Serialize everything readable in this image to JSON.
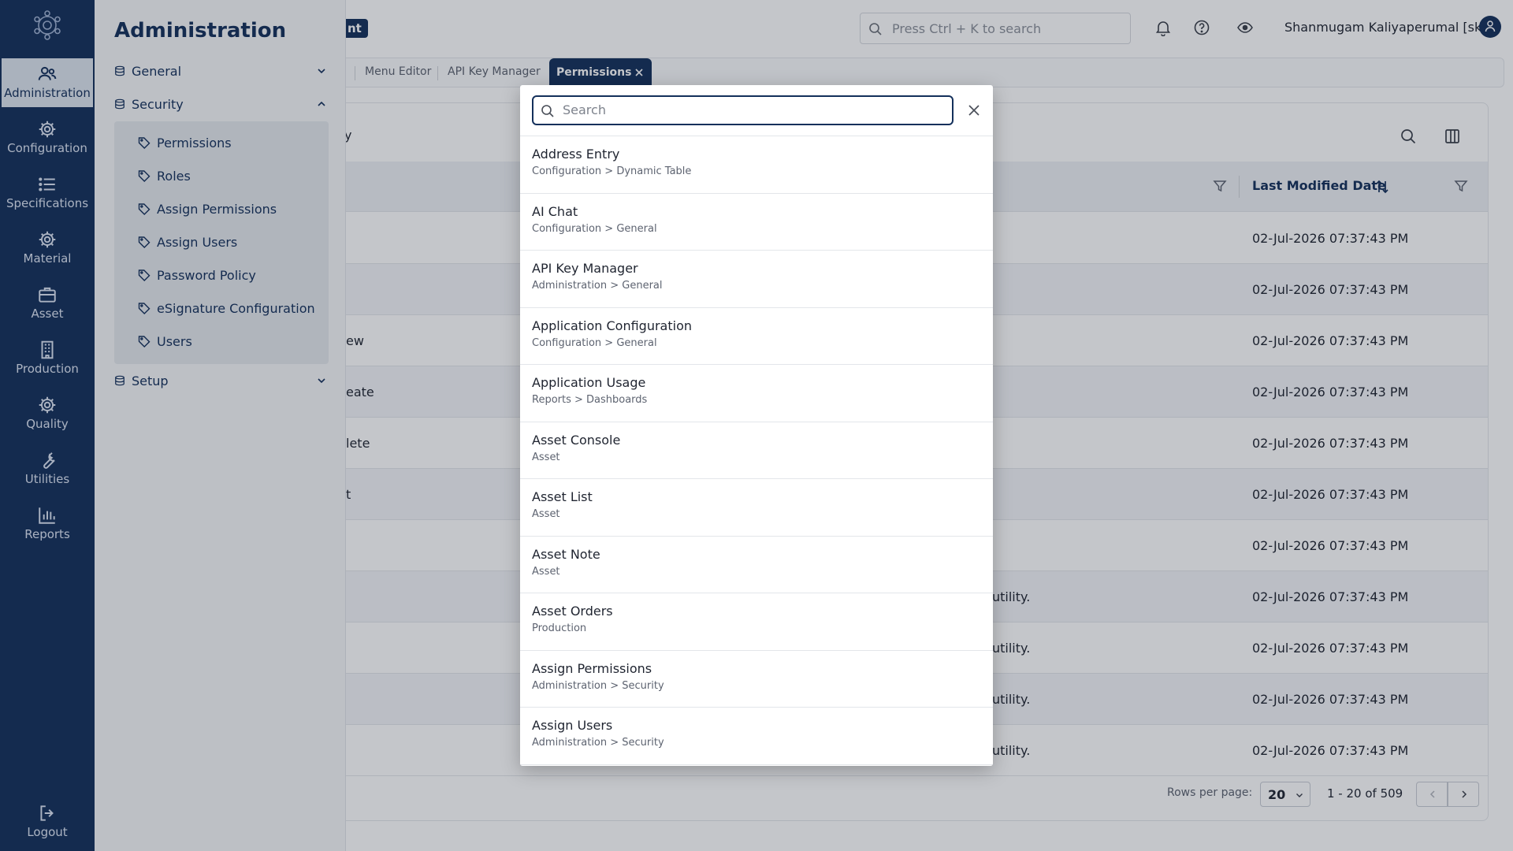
{
  "rail": {
    "items": [
      {
        "label": "Administration",
        "icon": "users-icon",
        "active": true
      },
      {
        "label": "Configuration",
        "icon": "gear-icon"
      },
      {
        "label": "Specifications",
        "icon": "list-icon"
      },
      {
        "label": "Material",
        "icon": "gear-icon"
      },
      {
        "label": "Asset",
        "icon": "briefcase-icon"
      },
      {
        "label": "Production",
        "icon": "building-icon"
      },
      {
        "label": "Quality",
        "icon": "gear-icon"
      },
      {
        "label": "Utilities",
        "icon": "wrench-icon"
      },
      {
        "label": "Reports",
        "icon": "bar-chart-icon"
      }
    ],
    "logout": "Logout"
  },
  "panel": {
    "title": "Administration",
    "groups": {
      "general": "General",
      "security": "Security",
      "setup": "Setup"
    },
    "security_items": [
      "Permissions",
      "Roles",
      "Assign Permissions",
      "Assign Users",
      "Password Policy",
      "eSignature Configuration",
      "Users"
    ]
  },
  "header": {
    "brand_fragment": "nt",
    "search_placeholder": "Press Ctrl + K to search",
    "user_name": "Shanmugam Kaliyaperumal [sk]"
  },
  "tabs": {
    "items": [
      "Menu Editor",
      "API Key Manager"
    ],
    "active": "Permissions"
  },
  "table": {
    "title_fragment": "y",
    "sort_column": "Last Modified Date",
    "rows": [
      {
        "c1": "",
        "c2": "",
        "c3": "02-Jul-2026 07:37:43 PM"
      },
      {
        "c1": "",
        "c2": "",
        "c3": "02-Jul-2026 07:37:43 PM"
      },
      {
        "c1": "ew",
        "c2": "",
        "c3": "02-Jul-2026 07:37:43 PM"
      },
      {
        "c1": "eate",
        "c2": "",
        "c3": "02-Jul-2026 07:37:43 PM"
      },
      {
        "c1": "lete",
        "c2": "",
        "c3": "02-Jul-2026 07:37:43 PM"
      },
      {
        "c1": "t",
        "c2": "",
        "c3": "02-Jul-2026 07:37:43 PM"
      },
      {
        "c1": "",
        "c2": "",
        "c3": "02-Jul-2026 07:37:43 PM"
      },
      {
        "c1": "",
        "c2": "utility.",
        "c3": "02-Jul-2026 07:37:43 PM"
      },
      {
        "c1": "",
        "c2": "utility.",
        "c3": "02-Jul-2026 07:37:43 PM"
      },
      {
        "c1": "",
        "c2": "utility.",
        "c3": "02-Jul-2026 07:37:43 PM"
      },
      {
        "c1": "",
        "c2": "utility.",
        "c3": "02-Jul-2026 07:37:43 PM"
      }
    ]
  },
  "pager": {
    "rows_per_page_label": "Rows per page:",
    "rows_per_page": "20",
    "range": "1 - 20 of 509"
  },
  "modal": {
    "search_placeholder": "Search",
    "results": [
      {
        "title": "Address Entry",
        "path": "Configuration > Dynamic Table"
      },
      {
        "title": "AI Chat",
        "path": "Configuration > General"
      },
      {
        "title": "API Key Manager",
        "path": "Administration > General"
      },
      {
        "title": "Application Configuration",
        "path": "Configuration > General"
      },
      {
        "title": "Application Usage",
        "path": "Reports > Dashboards"
      },
      {
        "title": "Asset Console",
        "path": "Asset"
      },
      {
        "title": "Asset List",
        "path": "Asset"
      },
      {
        "title": "Asset Note",
        "path": "Asset"
      },
      {
        "title": "Asset Orders",
        "path": "Production"
      },
      {
        "title": "Assign Permissions",
        "path": "Administration > Security"
      },
      {
        "title": "Assign Users",
        "path": "Administration > Security"
      },
      {
        "title": "",
        "path": ""
      }
    ]
  },
  "colors": {
    "brand_navy": "#14305b",
    "rail_active_bg": "#dde4ee",
    "overlay": "rgba(20,28,45,0.25)"
  }
}
